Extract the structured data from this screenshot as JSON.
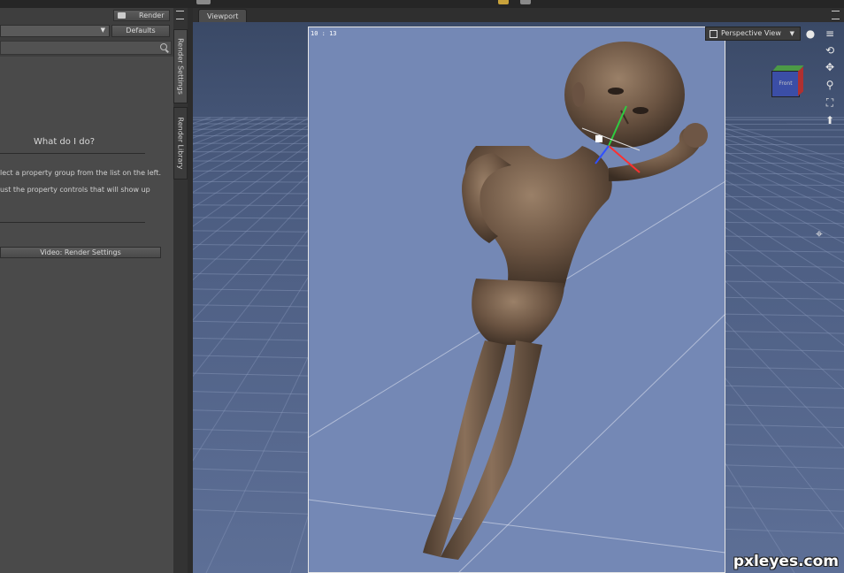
{
  "render_panel": {
    "render_button": "Render",
    "defaults_button": "Defaults",
    "help_title": "What do I do?",
    "help_line1": "lect a property group from the list on the left.",
    "help_line2": "ust the property controls that will show up",
    "video_button": "Video: Render Settings"
  },
  "side_tabs": {
    "render_settings": "Render Settings",
    "render_library": "Render Library"
  },
  "viewport": {
    "tab_label": "Viewport",
    "frame_counter": "10 : 13",
    "view_select": "Perspective View",
    "cube_face": "Front"
  },
  "watermark": "pxleyes.com",
  "icons": [
    "camera-icon",
    "menu-icon",
    "chevron-down-icon",
    "search-icon",
    "view-layout-icon",
    "shading-sphere-icon",
    "orbit-icon",
    "pan-icon",
    "zoom-icon",
    "frame-icon",
    "reset-view-icon",
    "pointer-icon",
    "figure-icon"
  ]
}
